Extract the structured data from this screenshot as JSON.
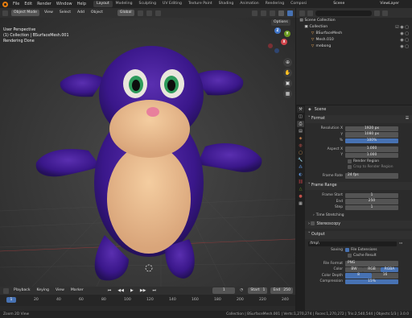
{
  "topbar": {
    "menus": [
      "File",
      "Edit",
      "Render",
      "Window",
      "Help"
    ],
    "workspaces": [
      "Layout",
      "Modeling",
      "Sculpting",
      "UV Editing",
      "Texture Paint",
      "Shading",
      "Animation",
      "Rendering",
      "Composi"
    ],
    "scene": "Scene",
    "view_layer": "ViewLayer"
  },
  "viewport": {
    "mode": "Object Mode",
    "menus": [
      "View",
      "Select",
      "Add",
      "Object"
    ],
    "orientation": "Global",
    "options": "Options",
    "overlay_line1": "User Perspective",
    "overlay_line2": "(1) Collection | BSurfaceMesh.001",
    "overlay_line3": "Rendering Done",
    "gizmo": {
      "x": "X",
      "y": "Y",
      "z": "Z"
    }
  },
  "timeline": {
    "menus": [
      "Playback",
      "Keying",
      "View",
      "Marker"
    ],
    "current_frame": "1",
    "start_label": "Start",
    "start": "1",
    "end_label": "End",
    "end": "250",
    "ticks": [
      "0",
      "20",
      "40",
      "60",
      "80",
      "100",
      "120",
      "140",
      "160",
      "180",
      "200",
      "220",
      "240"
    ]
  },
  "status": {
    "left": "Zoom 2D View",
    "right": "Collection | BSurfaceMesh.001 | Verts:1,270,274 | Faces:1,270,272 | Tris:2,540,544 | Objects:1/3 | 3.0.0"
  },
  "outliner": {
    "header_search": "",
    "items": [
      {
        "label": "Scene Collection",
        "indent": 0
      },
      {
        "label": "Collection",
        "indent": 1
      },
      {
        "label": "BSurfaceMesh",
        "indent": 2
      },
      {
        "label": "Mesh.010",
        "indent": 2
      },
      {
        "label": "mebong",
        "indent": 2
      }
    ]
  },
  "properties": {
    "header": "Scene",
    "format": {
      "title": "Format",
      "res_x_label": "Resolution X",
      "res_x": "1920 px",
      "res_y_label": "Y",
      "res_y": "1080 px",
      "res_pct_label": "%",
      "res_pct": "100%",
      "aspect_x_label": "Aspect X",
      "aspect_x": "1.000",
      "aspect_y_label": "Y",
      "aspect_y": "1.000",
      "render_region": "Render Region",
      "crop": "Crop to Render Region",
      "frame_rate_label": "Frame Rate",
      "frame_rate": "24 fps"
    },
    "frame_range": {
      "title": "Frame Range",
      "start_label": "Frame Start",
      "start": "1",
      "end_label": "End",
      "end": "250",
      "step_label": "Step",
      "step": "1"
    },
    "time_stretching": "Time Stretching",
    "stereoscopy": "Stereoscopy",
    "output": {
      "title": "Output",
      "path": "/tmp\\",
      "saving_label": "Saving",
      "file_ext": "File Extensions",
      "cache": "Cache Result",
      "format_label": "File Format",
      "format": "PNG",
      "color_label": "Color",
      "color_bw": "BW",
      "color_rgb": "RGB",
      "color_rgba": "RGBA",
      "depth_label": "Color Depth",
      "depth_8": "8",
      "depth_16": "16",
      "compression_label": "Compression",
      "compression": "15%"
    }
  }
}
